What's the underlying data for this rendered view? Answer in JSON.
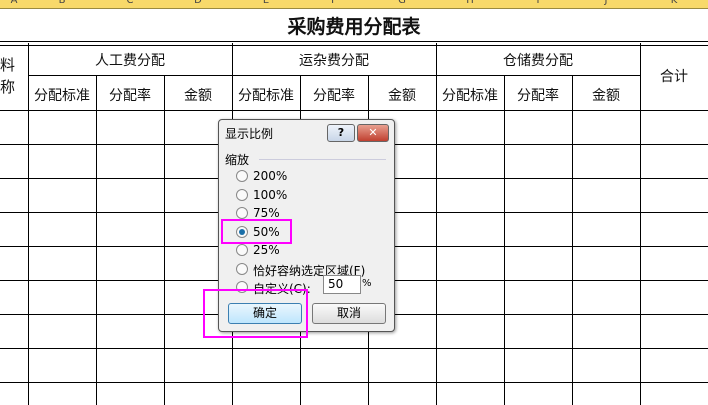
{
  "columns": [
    "A",
    "B",
    "C",
    "D",
    "E",
    "F",
    "G",
    "H",
    "I",
    "J",
    "K"
  ],
  "title": "采购费用分配表",
  "left_header": [
    "料",
    "称"
  ],
  "groups": [
    "人工费分配",
    "运杂费分配",
    "仓储费分配"
  ],
  "sub": [
    "分配标准",
    "分配率",
    "金额"
  ],
  "total": "合计",
  "dialog": {
    "title": "显示比例",
    "help": "?",
    "close": "✕",
    "section": "缩放",
    "options": [
      "200%",
      "100%",
      "75%",
      "50%",
      "25%",
      "恰好容纳选定区域(F)",
      "自定义(C):"
    ],
    "selected": "50%",
    "custom_value": "50",
    "percent": "%",
    "ok": "确定",
    "cancel": "取消"
  },
  "highlight_color": "#ff00ff"
}
